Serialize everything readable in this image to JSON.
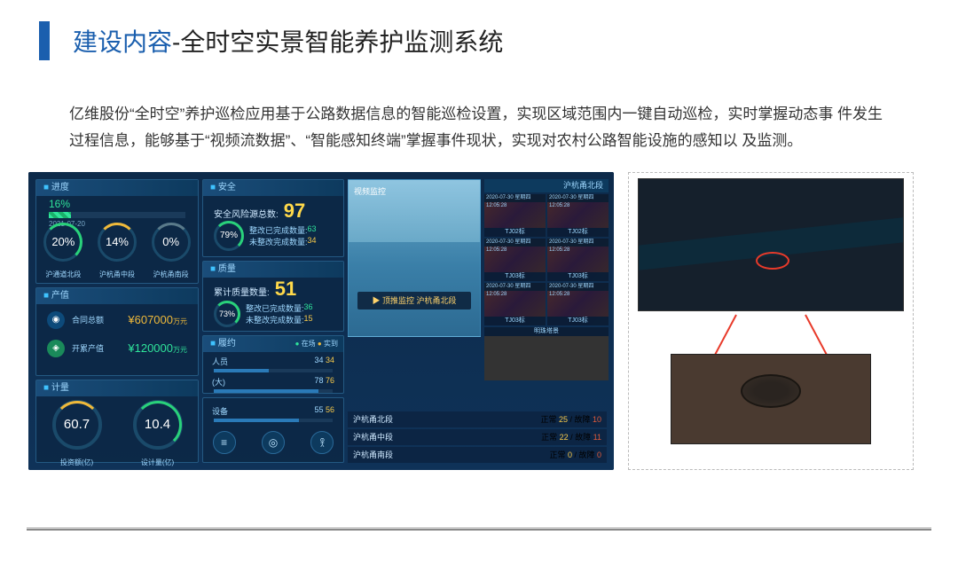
{
  "header": {
    "title_blue": "建设内容",
    "title_sep": "-",
    "title_black": "全时空实景智能养护监测系统"
  },
  "body": {
    "paragraph": "亿维股份“全时空”养护巡检应用基于公路数据信息的智能巡检设置，实现区域范围内一键自动巡检，实时掌握动态事  件发生过程信息，能够基于“视频流数据”、“智能感知终端”掌握事件现状，实现对农村公路智能设施的感知以  及监测。"
  },
  "dashboard": {
    "panel_progress": {
      "title": "进度",
      "pct": "16%",
      "date": "2021-07-20",
      "rings": [
        {
          "val": "20%",
          "lbl": "沪通道北段"
        },
        {
          "val": "14%",
          "lbl": "沪杭甬中段"
        },
        {
          "val": "0%",
          "lbl": "沪杭甬南段"
        }
      ]
    },
    "panel_output": {
      "title": "产值",
      "rows": [
        {
          "icon": "person-icon",
          "label": "合同总额",
          "value": "¥607000",
          "unit": "万元"
        },
        {
          "icon": "building-icon",
          "label": "开累产值",
          "value": "¥120000",
          "unit": "万元"
        }
      ]
    },
    "panel_plan": {
      "title": "计量",
      "rings": [
        {
          "val": "60.7",
          "lbl": "投资额(亿)"
        },
        {
          "val": "10.4",
          "lbl": "设计量(亿)"
        }
      ]
    },
    "panel_safety": {
      "title": "安全",
      "label": "安全风险源总数:",
      "value": "97",
      "ring": "79%",
      "sub": [
        {
          "lbl": "整改已完成数量:",
          "v": "63",
          "cls": "g"
        },
        {
          "lbl": "未整改完成数量:",
          "v": "34",
          "cls": "y"
        }
      ]
    },
    "panel_quality": {
      "title": "质量",
      "label": "累计质量数量:",
      "value": "51",
      "ring": "73%",
      "sub": [
        {
          "lbl": "整改已完成数量:",
          "v": "36",
          "cls": "g"
        },
        {
          "lbl": "未整改完成数量:",
          "v": "15",
          "cls": "y"
        }
      ]
    },
    "panel_contract": {
      "title": "履约",
      "legend": [
        {
          "k": "在场",
          "c": "#2fe39a"
        },
        {
          "k": "实到",
          "c": "#efb93a"
        }
      ],
      "rows": [
        {
          "lbl": "人员",
          "a": "34",
          "b": "34"
        },
        {
          "lbl": "(大)",
          "a": "78",
          "b": "76"
        },
        {
          "lbl": "设备",
          "a": "55",
          "b": "56"
        }
      ]
    },
    "scene": {
      "header": "视频监控",
      "banner": "顶推监控  沪杭甬北段",
      "corner": "沪杭甬北段"
    },
    "video": {
      "tiles": [
        {
          "date": "2020-07-30  星期四  12:05:28",
          "lbl": "TJ02标"
        },
        {
          "date": "2020-07-30  星期四  12:05:28",
          "lbl": "TJ02标"
        },
        {
          "date": "2020-07-30  星期四  12:05:28",
          "lbl": "TJ03标"
        },
        {
          "date": "2020-07-30  星期四  12:05:28",
          "lbl": "TJ03标"
        },
        {
          "date": "2020-07-30  星期四  12:05:28",
          "lbl": "TJ03标"
        },
        {
          "date": "2020-07-30  星期四  12:05:28",
          "lbl": "TJ03标"
        }
      ],
      "wide_lbl": "明珠塔景"
    },
    "status": [
      {
        "name": "沪杭甬北段",
        "ok": "25",
        "bad": "10"
      },
      {
        "name": "沪杭甬中段",
        "ok": "22",
        "bad": "11"
      },
      {
        "name": "沪杭甬南段",
        "ok": "0",
        "bad": "0"
      }
    ],
    "status_fmt": {
      "ok_lbl": "正常 ",
      "sep": " / 故障 "
    },
    "corner_lbl": "沪杭甬北段"
  }
}
